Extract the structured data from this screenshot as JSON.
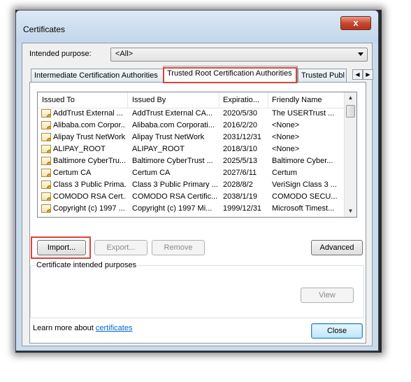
{
  "window": {
    "title": "Certificates",
    "close_glyph": "x"
  },
  "purpose": {
    "label": "Intended purpose:",
    "value": "<All>"
  },
  "tabs": [
    {
      "label": "Intermediate Certification Authorities"
    },
    {
      "label": "Trusted Root Certification Authorities"
    },
    {
      "label": "Trusted Publ"
    }
  ],
  "tab_scroll": {
    "left": "◀",
    "right": "▶"
  },
  "columns": [
    "Issued To",
    "Issued By",
    "Expiratio...",
    "Friendly Name"
  ],
  "rows": [
    {
      "issued_to": "AddTrust External ...",
      "issued_by": "AddTrust External CA...",
      "expiration": "2020/5/30",
      "friendly_name": "The USERTrust ..."
    },
    {
      "issued_to": "Alibaba.com Corpor...",
      "issued_by": "Alibaba.com Corporati...",
      "expiration": "2016/2/20",
      "friendly_name": "<None>"
    },
    {
      "issued_to": "Alipay Trust NetWork",
      "issued_by": "Alipay Trust NetWork",
      "expiration": "2031/12/31",
      "friendly_name": "<None>"
    },
    {
      "issued_to": "ALIPAY_ROOT",
      "issued_by": "ALIPAY_ROOT",
      "expiration": "2018/3/10",
      "friendly_name": "<None>"
    },
    {
      "issued_to": "Baltimore CyberTru...",
      "issued_by": "Baltimore CyberTrust ...",
      "expiration": "2025/5/13",
      "friendly_name": "Baltimore Cyber..."
    },
    {
      "issued_to": "Certum CA",
      "issued_by": "Certum CA",
      "expiration": "2027/6/11",
      "friendly_name": "Certum"
    },
    {
      "issued_to": "Class 3 Public Prima...",
      "issued_by": "Class 3 Public Primary ...",
      "expiration": "2028/8/2",
      "friendly_name": "VeriSign Class 3 ..."
    },
    {
      "issued_to": "COMODO RSA Cert...",
      "issued_by": "COMODO RSA Certific...",
      "expiration": "2038/1/19",
      "friendly_name": "COMODO SECU..."
    },
    {
      "issued_to": "Copyright (c) 1997 ...",
      "issued_by": "Copyright (c) 1997 Mi...",
      "expiration": "1999/12/31",
      "friendly_name": "Microsoft Timest..."
    }
  ],
  "buttons": {
    "import": "Import...",
    "export": "Export...",
    "remove": "Remove",
    "advanced": "Advanced",
    "view": "View",
    "close": "Close"
  },
  "purposes_group": {
    "label": "Certificate intended purposes"
  },
  "footer": {
    "learn_text": "Learn more about ",
    "learn_link": "certificates"
  },
  "scroll": {
    "up": "▲",
    "down": "▼"
  },
  "colors": {
    "highlight": "#d9443a",
    "link": "#0066cc",
    "close_button": "#c7432c"
  }
}
